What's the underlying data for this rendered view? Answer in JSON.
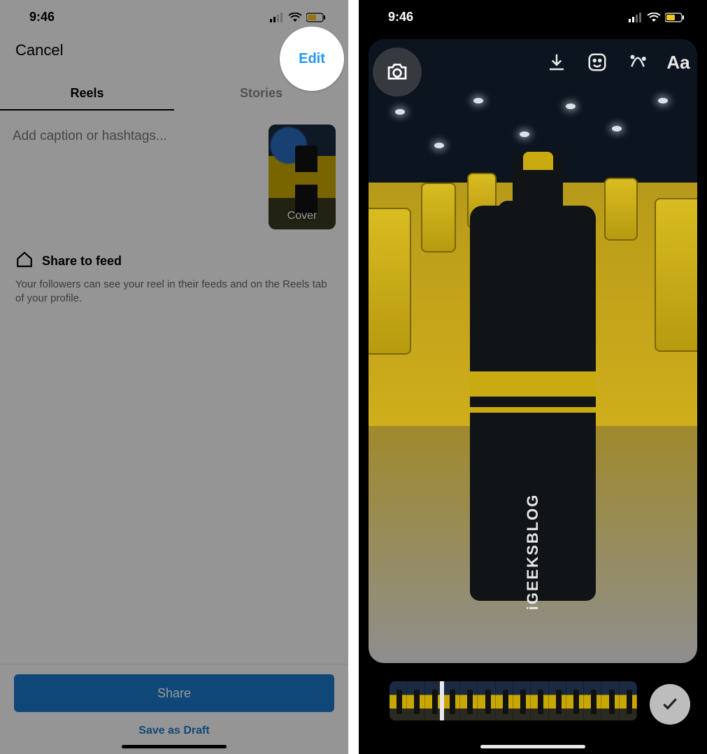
{
  "left": {
    "status": {
      "time": "9:46"
    },
    "nav": {
      "cancel": "Cancel",
      "edit": "Edit"
    },
    "tabs": {
      "reels": "Reels",
      "stories": "Stories"
    },
    "caption_placeholder": "Add caption or hashtags...",
    "cover_label": "Cover",
    "share_feed": {
      "title": "Share to feed",
      "desc": "Your followers can see your reel in their feeds and on the Reels tab of your profile."
    },
    "actions": {
      "share": "Share",
      "draft": "Save as Draft"
    }
  },
  "right": {
    "status": {
      "time": "9:46"
    },
    "brand_text": "iGEEKSBLOG",
    "tools": {
      "camera": "camera-icon",
      "download": "download-icon",
      "sticker": "sticker-icon",
      "effects": "effects-icon",
      "text": "Aa"
    }
  },
  "colors": {
    "accent_blue": "#2196f3",
    "primary_blue": "#1978c8",
    "brand_yellow": "#c9aa10"
  }
}
